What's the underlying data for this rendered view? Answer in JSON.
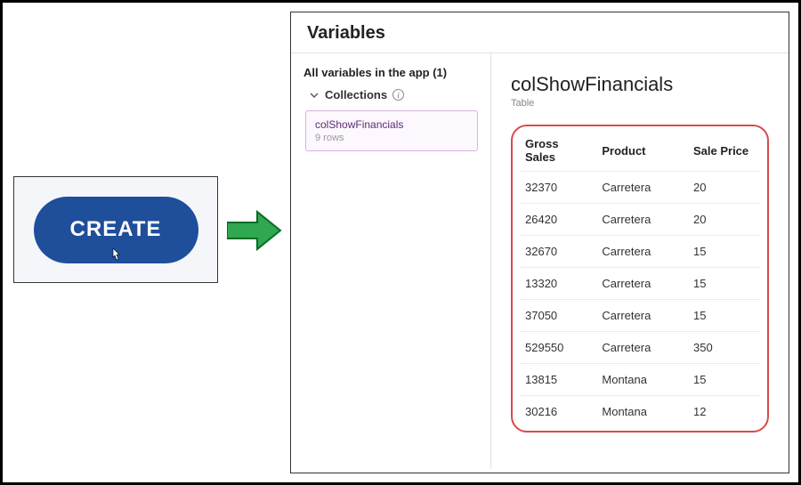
{
  "button": {
    "create_label": "CREATE"
  },
  "panel": {
    "title": "Variables",
    "all_vars_label": "All variables in the app (1)",
    "tree": {
      "collections_label": "Collections"
    },
    "collection_card": {
      "name": "colShowFinancials",
      "rows_label": "9 rows"
    },
    "detail": {
      "title": "colShowFinancials",
      "type": "Table"
    },
    "table": {
      "headers": [
        "Gross Sales",
        "Product",
        "Sale Price"
      ],
      "rows": [
        [
          "32370",
          "Carretera",
          "20"
        ],
        [
          "26420",
          "Carretera",
          "20"
        ],
        [
          "32670",
          "Carretera",
          "15"
        ],
        [
          "13320",
          "Carretera",
          "15"
        ],
        [
          "37050",
          "Carretera",
          "15"
        ],
        [
          "529550",
          "Carretera",
          "350"
        ],
        [
          "13815",
          "Montana",
          "15"
        ],
        [
          "30216",
          "Montana",
          "12"
        ]
      ]
    }
  }
}
